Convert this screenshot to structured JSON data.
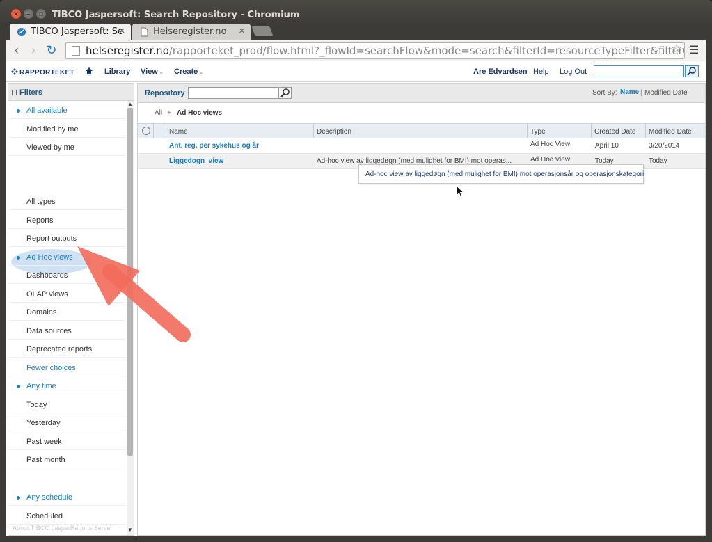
{
  "window": {
    "title": "TIBCO Jaspersoft: Search Repository - Chromium"
  },
  "tabs": [
    {
      "label": "TIBCO Jaspersoft: Se"
    },
    {
      "label": "Helseregister.no"
    }
  ],
  "address": {
    "host": "helseregister.no",
    "path": "/rapporteket_prod/flow.html?_flowId=searchFlow&mode=search&filterId=resourceTypeFilter&filterOption=resourc"
  },
  "header": {
    "logo": "RAPPORTEKET",
    "nav": [
      "Library",
      "View",
      "Create"
    ],
    "user": "Are Edvardsen",
    "help": "Help",
    "logout": "Log Out"
  },
  "sidebar": {
    "title": "Filters",
    "groups": [
      {
        "items": [
          {
            "label": "All available",
            "selected": true
          },
          {
            "label": "Modified by me",
            "selected": false
          },
          {
            "label": "Viewed by me",
            "selected": false
          }
        ]
      },
      {
        "items": [
          {
            "label": "All types",
            "selected": false
          },
          {
            "label": "Reports",
            "selected": false
          },
          {
            "label": "Report outputs",
            "selected": false
          },
          {
            "label": "Ad Hoc views",
            "selected": true
          },
          {
            "label": "Dashboards",
            "selected": false
          },
          {
            "label": "OLAP views",
            "selected": false
          },
          {
            "label": "Domains",
            "selected": false
          },
          {
            "label": "Data sources",
            "selected": false
          },
          {
            "label": "Deprecated reports",
            "selected": false
          },
          {
            "label": "Fewer choices",
            "selected": false,
            "link": true
          }
        ]
      },
      {
        "items": [
          {
            "label": "Any time",
            "selected": true
          },
          {
            "label": "Today",
            "selected": false
          },
          {
            "label": "Yesterday",
            "selected": false
          },
          {
            "label": "Past week",
            "selected": false
          },
          {
            "label": "Past month",
            "selected": false
          }
        ]
      },
      {
        "items": [
          {
            "label": "Any schedule",
            "selected": true
          },
          {
            "label": "Scheduled",
            "selected": false
          }
        ]
      }
    ]
  },
  "repository": {
    "title": "Repository",
    "sort_label": "Sort By:",
    "sort_options": [
      "Name",
      "Modified Date"
    ],
    "breadcrumb": [
      "All",
      "Ad Hoc views"
    ],
    "columns": [
      "Name",
      "Description",
      "Type",
      "Created Date",
      "Modified Date"
    ],
    "rows": [
      {
        "name": "Ant. reg. per sykehus og år",
        "description": "",
        "type": "Ad Hoc View",
        "created": "April 10",
        "modified": "3/20/2014"
      },
      {
        "name": "Liggedogn_view",
        "description": "Ad-hoc view av liggedøgn (med mulighet for BMI) mot operas...",
        "type": "Ad Hoc View",
        "created": "Today",
        "modified": "Today"
      }
    ],
    "tooltip": "Ad-hoc view av liggedøgn (med mulighet for BMI) mot operasjonsår og operasjonskategori"
  },
  "footer": {
    "text": "About TIBCO JasperReports Server"
  },
  "colors": {
    "accent": "#1a7fc4",
    "arrow": "#f26b5b"
  }
}
